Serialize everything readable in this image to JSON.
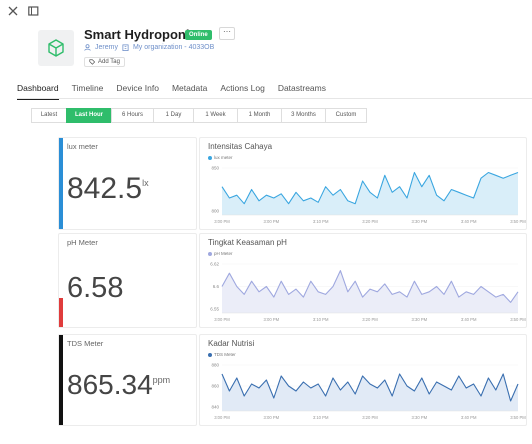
{
  "device": {
    "title": "Smart Hydroponic",
    "status": "Online",
    "more": "⋯",
    "owner": "Jeremy",
    "organization": "My organization - 4033OB",
    "add_tag": "Add Tag"
  },
  "tabs": [
    "Dashboard",
    "Timeline",
    "Device Info",
    "Metadata",
    "Actions Log",
    "Datastreams"
  ],
  "ranges": [
    "Latest",
    "Last Hour",
    "6 Hours",
    "1 Day",
    "1 Week",
    "1 Month",
    "3 Months",
    "Custom"
  ],
  "widgets": [
    {
      "title": "lux meter",
      "value": "842.5",
      "unit": "lx",
      "color": "#2a8ed6"
    },
    {
      "title": "pH Meter",
      "value": "6.58",
      "unit": "",
      "color": "#e03c3c"
    },
    {
      "title": "TDS Meter",
      "value": "865.34",
      "unit": "ppm",
      "color": "#111111"
    }
  ],
  "chart_data": [
    {
      "type": "area",
      "title": "Intensitas Cahaya",
      "color": "#3aa6e0",
      "fill": "#d9eef9",
      "series": [
        {
          "name": "lux meter",
          "values": [
            820,
            780,
            790,
            760,
            810,
            770,
            790,
            780,
            795,
            760,
            800,
            770,
            780,
            765,
            820,
            790,
            810,
            770,
            760,
            840,
            800,
            780,
            860,
            800,
            820,
            780,
            870,
            820,
            860,
            790,
            770,
            810,
            800,
            790,
            780,
            850,
            870,
            860,
            850,
            860,
            870
          ]
        }
      ],
      "ylim": [
        720,
        900
      ],
      "yticks": [
        "850",
        "800"
      ],
      "xticks": [
        "3:00 PM",
        "3:00 PM",
        "3:10 PM",
        "3:20 PM",
        "3:30 PM",
        "3:40 PM",
        "3:50 PM"
      ]
    },
    {
      "type": "area",
      "title": "Tingkat Keasaman pH",
      "color": "#9fa8df",
      "fill": "#ebedf8",
      "series": [
        {
          "name": "pH Meter",
          "values": [
            6.59,
            6.615,
            6.59,
            6.575,
            6.6,
            6.58,
            6.59,
            6.57,
            6.6,
            6.575,
            6.585,
            6.57,
            6.6,
            6.58,
            6.575,
            6.59,
            6.62,
            6.58,
            6.6,
            6.57,
            6.585,
            6.58,
            6.595,
            6.575,
            6.58,
            6.57,
            6.6,
            6.575,
            6.58,
            6.59,
            6.575,
            6.6,
            6.57,
            6.58,
            6.575,
            6.59,
            6.58,
            6.57,
            6.575,
            6.56,
            6.58
          ]
        }
      ],
      "ylim": [
        6.54,
        6.64
      ],
      "yticks": [
        "6.62",
        "6.6",
        "6.55"
      ],
      "xticks": [
        "3:00 PM",
        "3:00 PM",
        "3:10 PM",
        "3:20 PM",
        "3:30 PM",
        "3:40 PM",
        "3:50 PM"
      ]
    },
    {
      "type": "area",
      "title": "Kadar Nutrisi",
      "color": "#3a6fb0",
      "fill": "#e1eaf6",
      "series": [
        {
          "name": "TDS Meter",
          "values": [
            872,
            855,
            868,
            850,
            862,
            858,
            866,
            848,
            870,
            860,
            855,
            864,
            858,
            862,
            850,
            868,
            856,
            864,
            852,
            870,
            862,
            858,
            866,
            850,
            872,
            860,
            855,
            868,
            852,
            864,
            860,
            856,
            870,
            858,
            862,
            850,
            868,
            856,
            872,
            845,
            862
          ]
        }
      ],
      "ylim": [
        835,
        885
      ],
      "yticks": [
        "880",
        "860",
        "840"
      ],
      "xticks": [
        "3:00 PM",
        "3:00 PM",
        "3:10 PM",
        "3:20 PM",
        "3:30 PM",
        "3:40 PM",
        "3:50 PM"
      ]
    }
  ]
}
